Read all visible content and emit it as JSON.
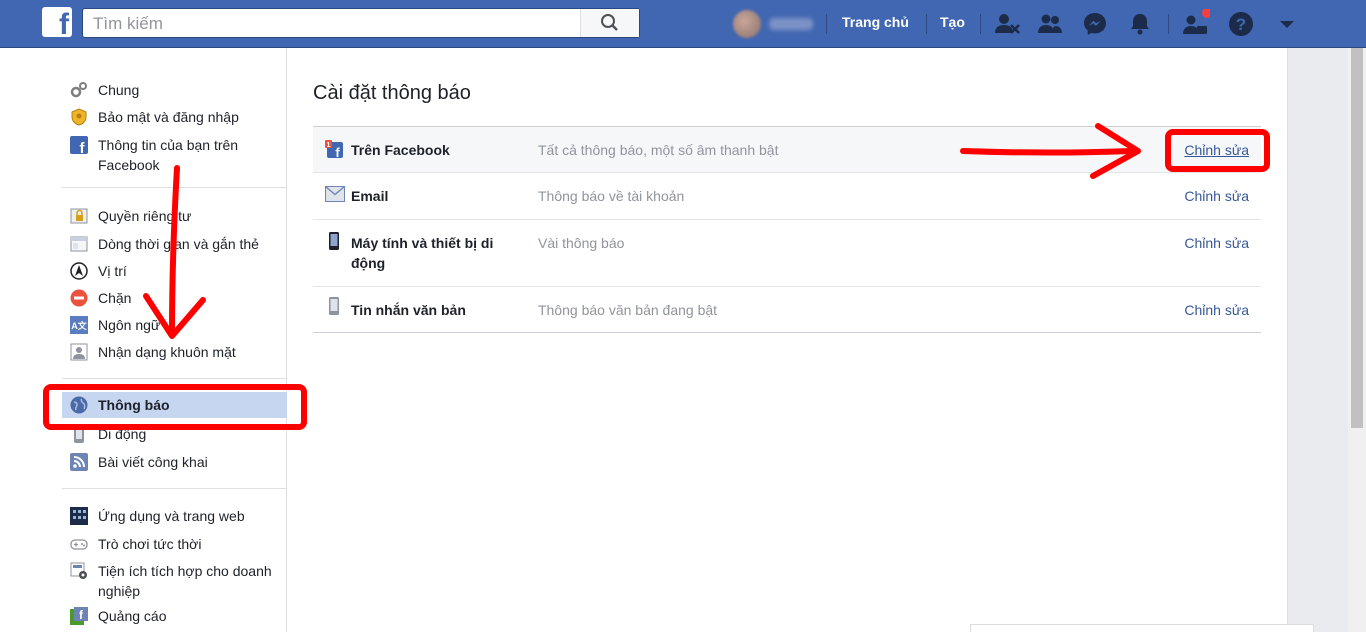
{
  "topbar": {
    "logo": "f",
    "search_placeholder": "Tìm kiếm",
    "home_label": "Trang chủ",
    "create_label": "Tạo",
    "icons": [
      "search-icon",
      "friend-requests-icon",
      "people-icon",
      "messenger-icon",
      "bell-icon",
      "account-icon",
      "help-icon",
      "caret-down-icon"
    ],
    "badge_color": "#fa3e3e"
  },
  "sidebar": {
    "groups": [
      [
        {
          "label": "Chung",
          "icon": "gear-icon"
        },
        {
          "label": "Bảo mật và đăng nhập",
          "icon": "shield-icon"
        },
        {
          "label": "Thông tin của bạn trên Facebook",
          "icon": "facebook-icon"
        }
      ],
      [
        {
          "label": "Quyền riêng tư",
          "icon": "lock-icon"
        },
        {
          "label": "Dòng thời gian và gắn thẻ",
          "icon": "timeline-icon"
        },
        {
          "label": "Vị trí",
          "icon": "location-icon"
        },
        {
          "label": "Chặn",
          "icon": "block-icon"
        },
        {
          "label": "Ngôn ngữ",
          "icon": "language-icon"
        },
        {
          "label": "Nhận dạng khuôn mặt",
          "icon": "face-icon"
        }
      ],
      [
        {
          "label": "Thông báo",
          "icon": "globe-icon",
          "active": true
        },
        {
          "label": "Di động",
          "icon": "mobile-icon"
        },
        {
          "label": "Bài viết công khai",
          "icon": "rss-icon"
        }
      ],
      [
        {
          "label": "Ứng dụng và trang web",
          "icon": "apps-icon"
        },
        {
          "label": "Trò chơi tức thời",
          "icon": "gamepad-icon"
        },
        {
          "label": "Tiện ích tích hợp cho doanh nghiệp",
          "icon": "business-icon"
        },
        {
          "label": "Quảng cáo",
          "icon": "ads-icon"
        }
      ]
    ]
  },
  "main": {
    "title": "Cài đặt thông báo",
    "rows": [
      {
        "name": "Trên Facebook",
        "desc": "Tất cả thông báo, một số âm thanh bật",
        "edit": "Chỉnh sửa",
        "icon": "facebook-notif-icon"
      },
      {
        "name": "Email",
        "desc": "Thông báo về tài khoản",
        "edit": "Chỉnh sửa",
        "icon": "email-icon"
      },
      {
        "name": "Máy tính và thiết bị di động",
        "desc": "Vài thông báo",
        "edit": "Chỉnh sửa",
        "icon": "phone-icon"
      },
      {
        "name": "Tin nhắn văn bản",
        "desc": "Thông báo văn bản đang bật",
        "edit": "Chỉnh sửa",
        "icon": "sms-icon"
      }
    ]
  },
  "colors": {
    "brand": "#4267b2",
    "link": "#365899",
    "annotation": "#ff0000",
    "active_bg": "#c6d5f0"
  }
}
